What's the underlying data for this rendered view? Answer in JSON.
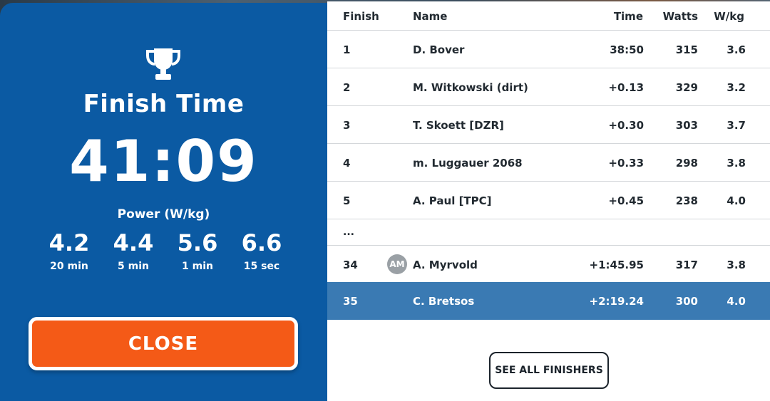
{
  "summary": {
    "finish_label": "Finish Time",
    "finish_time": "41:09",
    "power_label": "Power (W/kg)",
    "power": [
      {
        "value": "4.2",
        "unit": "20 min"
      },
      {
        "value": "4.4",
        "unit": "5 min"
      },
      {
        "value": "5.6",
        "unit": "1 min"
      },
      {
        "value": "6.6",
        "unit": "15 sec"
      }
    ],
    "close_label": "CLOSE",
    "trophy_icon": "trophy-icon"
  },
  "table": {
    "columns": {
      "finish": "Finish",
      "name": "Name",
      "time": "Time",
      "watts": "Watts",
      "wkg": "W/kg"
    },
    "rows": [
      {
        "finish": "1",
        "name": "D. Bover",
        "time": "38:50",
        "watts": "315",
        "wkg": "3.6"
      },
      {
        "finish": "2",
        "name": "M. Witkowski (dirt)",
        "time": "+0.13",
        "watts": "329",
        "wkg": "3.2"
      },
      {
        "finish": "3",
        "name": "T. Skoett [DZR]",
        "time": "+0.30",
        "watts": "303",
        "wkg": "3.7"
      },
      {
        "finish": "4",
        "name": "m. Luggauer 2068",
        "time": "+0.33",
        "watts": "298",
        "wkg": "3.8"
      },
      {
        "finish": "5",
        "name": "A. Paul [TPC]",
        "time": "+0.45",
        "watts": "238",
        "wkg": "4.0"
      }
    ],
    "ellipsis": "...",
    "lower_rows": [
      {
        "finish": "34",
        "avatar": "AM",
        "name": "A. Myrvold",
        "time": "+1:45.95",
        "watts": "317",
        "wkg": "3.8"
      },
      {
        "finish": "35",
        "name": "C. Bretsos",
        "time": "+2:19.24",
        "watts": "300",
        "wkg": "4.0"
      }
    ],
    "see_all_label": "SEE ALL FINISHERS"
  },
  "colors": {
    "left_panel": "#0b5aa3",
    "close_button": "#f45a17",
    "highlight_row": "#3a7ab3"
  }
}
